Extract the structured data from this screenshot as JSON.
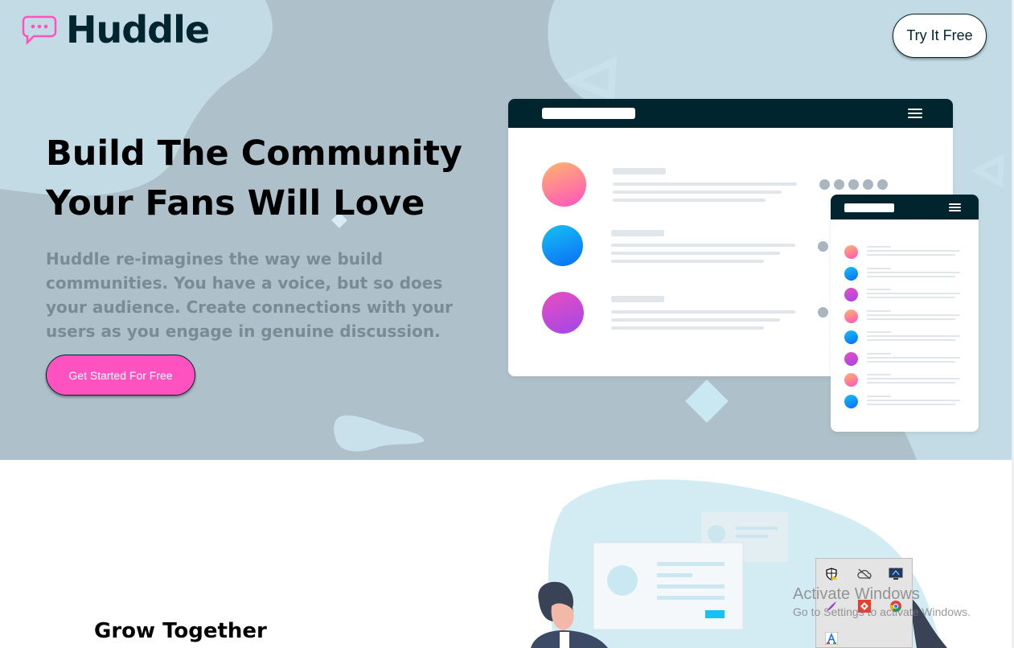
{
  "header": {
    "logo_text": "Huddle",
    "logo_icon": "chat-bubble-dots-icon",
    "try_button_label": "Try It Free"
  },
  "hero": {
    "headline_line1": "Build The Community",
    "headline_line2": "Your Fans Will Love",
    "description": "Huddle re-imagines the way we build communities. You have a voice, but so does your audience. Create connections with your users as you engage in genuine discussion.",
    "cta_label": "Get Started For Free"
  },
  "section2": {
    "title": "Grow Together"
  },
  "system": {
    "watermark_title": "Activate Windows",
    "watermark_subtitle": "Go to Settings to activate Windows.",
    "tray_icons": [
      "shield-warning-icon",
      "cloud-off-icon",
      "monitor-icon",
      "feather-icon",
      "anydesk-icon",
      "chrome-icon",
      "font-a-icon"
    ]
  },
  "colors": {
    "hero_bg": "#aec0c9",
    "dark_cyan": "#00252e",
    "pink": "#ff52c1",
    "gray_text": "#7b8b93",
    "light_blue_blob": "#c8e1ea"
  }
}
